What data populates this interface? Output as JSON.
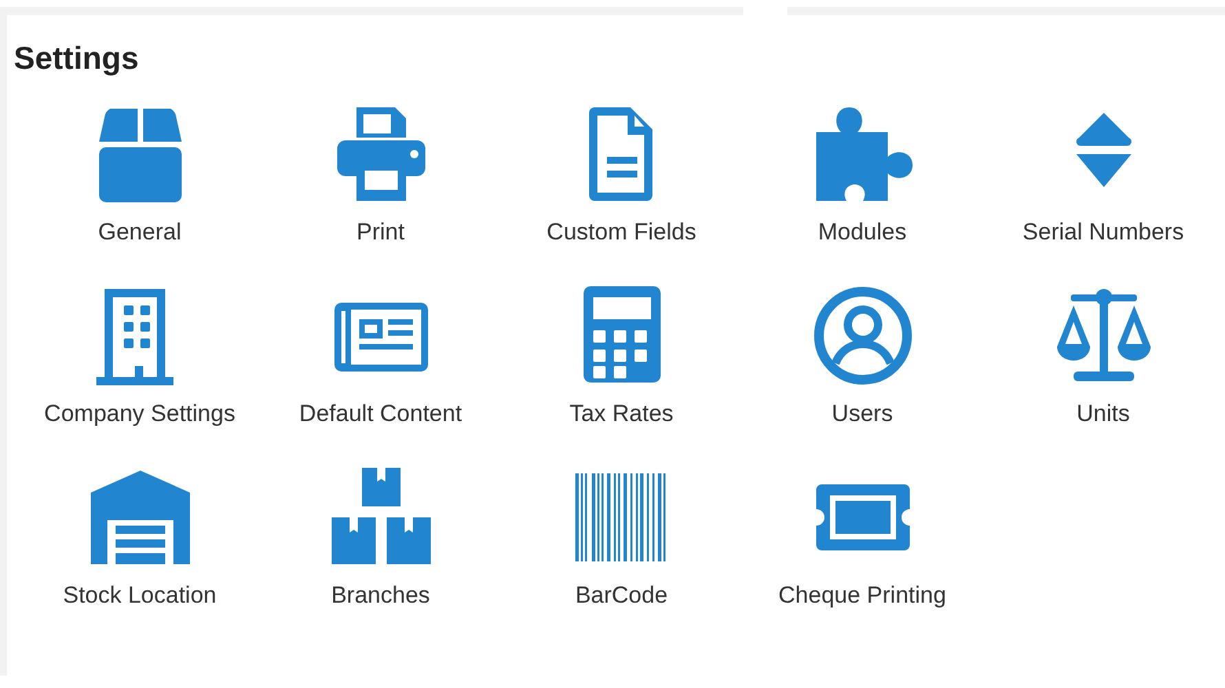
{
  "title": "Settings",
  "items": [
    {
      "label": "General",
      "kind": "box"
    },
    {
      "label": "Print",
      "kind": "printer"
    },
    {
      "label": "Custom Fields",
      "kind": "document"
    },
    {
      "label": "Modules",
      "kind": "puzzle"
    },
    {
      "label": "Serial Numbers",
      "kind": "sort"
    },
    {
      "label": "Company Settings",
      "kind": "building"
    },
    {
      "label": "Default Content",
      "kind": "newspaper"
    },
    {
      "label": "Tax Rates",
      "kind": "calculator"
    },
    {
      "label": "Users",
      "kind": "user"
    },
    {
      "label": "Units",
      "kind": "scale"
    },
    {
      "label": "Stock Location",
      "kind": "warehouse"
    },
    {
      "label": "Branches",
      "kind": "boxes"
    },
    {
      "label": "BarCode",
      "kind": "barcode"
    },
    {
      "label": "Cheque Printing",
      "kind": "ticket"
    }
  ]
}
